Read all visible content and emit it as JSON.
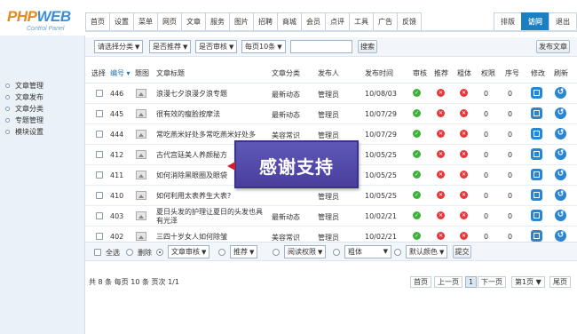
{
  "logo": {
    "brand_a": "PHP",
    "brand_b": "WEB",
    "sub": "Control Panel"
  },
  "topnav": [
    "首页",
    "设置",
    "菜单",
    "网页",
    "文章",
    "服务",
    "图片",
    "招聘",
    "商城",
    "会员",
    "点评",
    "工具",
    "广告",
    "反馈"
  ],
  "rightnav": {
    "layout": "排版",
    "visit": "访问",
    "logout": "退出"
  },
  "sidebar": [
    "文章管理",
    "文章发布",
    "文章分类",
    "专题管理",
    "模块设置"
  ],
  "filters": {
    "category": "请选择分类",
    "recommend": "是否推荐",
    "audit": "是否审核",
    "perpage": "每页10条",
    "search_value": "",
    "search_button": "搜索",
    "publish_button": "发布文章"
  },
  "columns": {
    "select": "选择",
    "id": "编号",
    "thumb": "题图",
    "title": "文章标题",
    "category": "文章分类",
    "author": "发布人",
    "time": "发布时间",
    "audit": "审核",
    "recommend": "推荐",
    "bold": "粗体",
    "weight": "权限",
    "order": "序号",
    "edit": "修改",
    "refresh": "刷新"
  },
  "rows": [
    {
      "id": "446",
      "title": "浪漫七夕浪漫夕浪专题",
      "category": "最新动态",
      "author": "管理员",
      "time": "10/08/03",
      "audit": true,
      "recommend": false,
      "bold": false,
      "weight": "0",
      "order": "0"
    },
    {
      "id": "445",
      "title": "很有效的瘦脸按摩法",
      "category": "最新动态",
      "author": "管理员",
      "time": "10/07/29",
      "audit": true,
      "recommend": false,
      "bold": false,
      "weight": "0",
      "order": "0"
    },
    {
      "id": "444",
      "title": "常吃燕米好处多常吃燕米好处多",
      "category": "美容常识",
      "author": "管理员",
      "time": "10/07/29",
      "audit": true,
      "recommend": false,
      "bold": false,
      "weight": "0",
      "order": "0"
    },
    {
      "id": "412",
      "title": "古代宫廷美人养颜秘方",
      "category": "",
      "author": "",
      "time": "10/05/25",
      "audit": true,
      "recommend": false,
      "bold": false,
      "weight": "0",
      "order": "0"
    },
    {
      "id": "411",
      "title": "如何消除黑眼圈及眼袋",
      "category": "",
      "author": "",
      "time": "10/05/25",
      "audit": true,
      "recommend": false,
      "bold": false,
      "weight": "0",
      "order": "0"
    },
    {
      "id": "410",
      "title": "如何利用太表养生大表?",
      "category": "",
      "author": "管理员",
      "time": "10/05/25",
      "audit": true,
      "recommend": false,
      "bold": false,
      "weight": "0",
      "order": "0"
    },
    {
      "id": "403",
      "title": "夏日头发的护理让夏日的头发也具有光泽",
      "category": "最新动态",
      "author": "管理员",
      "time": "10/02/21",
      "audit": true,
      "recommend": false,
      "bold": false,
      "weight": "0",
      "order": "0"
    },
    {
      "id": "402",
      "title": "三四十岁女人如何除皱",
      "category": "美容常识",
      "author": "管理员",
      "time": "10/02/21",
      "audit": true,
      "recommend": false,
      "bold": false,
      "weight": "0",
      "order": "0"
    }
  ],
  "batch": {
    "select_all": "全选",
    "delete": "删除",
    "audit": "文章审核",
    "recommend": "推荐",
    "read_perm": "阅读权限",
    "bold": "粗体",
    "color": "默认颜色",
    "submit": "提交"
  },
  "pager": {
    "summary": "共 8 条 每页 10 条 页次 1/1",
    "first": "首页",
    "prev": "上一页",
    "current": "1",
    "next": "下一页",
    "jump": "第1页",
    "last": "尾页"
  },
  "overlay": {
    "text": "感谢支持"
  },
  "colors": {
    "accent": "#1b7fc2",
    "ok": "#3db23b",
    "no": "#e5383b",
    "overlay": "#4f46a8"
  }
}
